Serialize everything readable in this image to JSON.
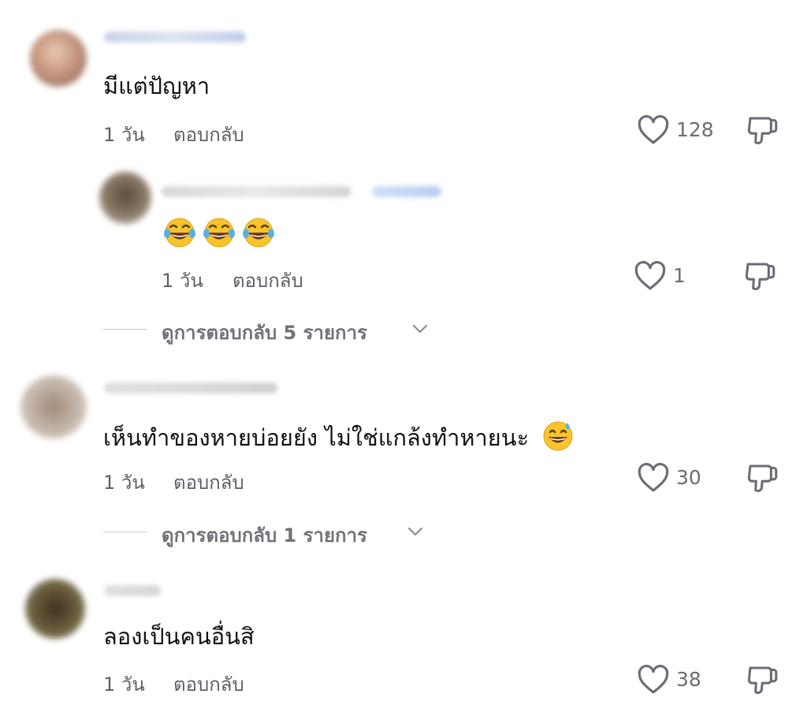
{
  "comments": [
    {
      "text": "มีแต่ปัญหา",
      "time": "1 วัน",
      "reply_label": "ตอบกลับ",
      "likes": "128",
      "avatar_color": "#c9a08a"
    },
    {
      "time": "1 วัน",
      "reply_label": "ตอบกลับ",
      "likes": "1",
      "emoji": [
        "laugh-cry",
        "laugh-cry",
        "laugh-cry"
      ],
      "avatar_color": "#7b6a5a"
    },
    {
      "text": "เห็นทำของหายบ่อยยัง ไม่ใช่แกล้งทำหายนะ",
      "time": "1 วัน",
      "reply_label": "ตอบกลับ",
      "likes": "30",
      "emoji": [
        "grin-sweat"
      ],
      "avatar_color": "#b9a79a"
    },
    {
      "text": "ลองเป็นคนอื่นสิ",
      "time": "1 วัน",
      "reply_label": "ตอบกลับ",
      "likes": "38",
      "avatar_color": "#6a5a3a"
    }
  ],
  "view_replies": [
    {
      "label": "ดูการตอบกลับ 5 รายการ"
    },
    {
      "label": "ดูการตอบกลับ 1 รายการ"
    }
  ],
  "colors": {
    "text": "#111111",
    "meta": "#5e6068",
    "icon": "#6b6d75"
  }
}
